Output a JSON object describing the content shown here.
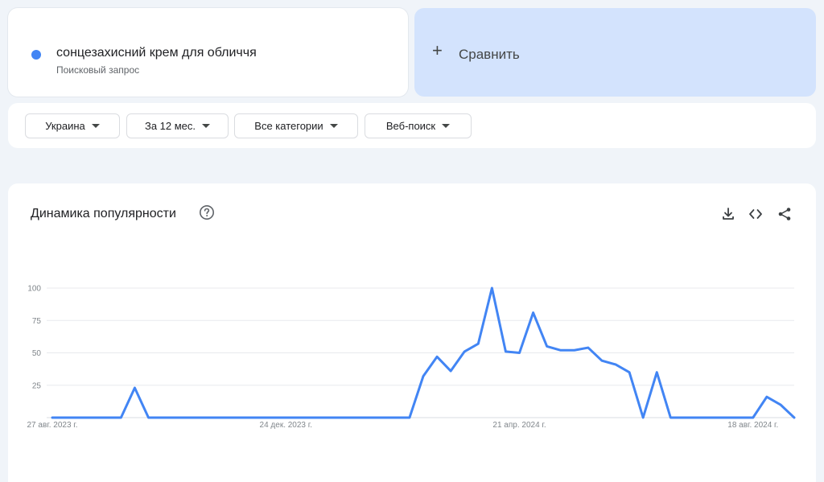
{
  "search_term": {
    "title": "сонцезахисний крем для обличчя",
    "subtitle": "Поисковый запрос",
    "color": "#4285f4"
  },
  "compare": {
    "icon": "plus-icon",
    "label": "Сравнить"
  },
  "filters": [
    {
      "label": "Украина",
      "icon": "caret-down-icon"
    },
    {
      "label": "За 12 мес.",
      "icon": "caret-down-icon"
    },
    {
      "label": "Все категории",
      "icon": "caret-down-icon"
    },
    {
      "label": "Веб-поиск",
      "icon": "caret-down-icon"
    }
  ],
  "chart_panel": {
    "title": "Динамика популярности",
    "help_icon": "help-circle-icon",
    "tools": [
      "download-icon",
      "embed-code-icon",
      "share-icon"
    ]
  },
  "colors": {
    "line": "#4285f4",
    "compare_bg": "#d3e3fd",
    "page_bg": "#f0f4f9",
    "grid": "#e8eaed"
  },
  "chart_data": {
    "type": "line",
    "x_tick_labels": [
      "27 авг. 2023 г.",
      "24 дек. 2023 г.",
      "21 апр. 2024 г.",
      "18 авг. 2024 г."
    ],
    "x_tick_indices": [
      0,
      17,
      34,
      51
    ],
    "y_ticks": [
      "25",
      "50",
      "75",
      "100"
    ],
    "y_tick_values": [
      25,
      50,
      75,
      100
    ],
    "ylim": [
      0,
      100
    ],
    "grid": true,
    "series": [
      {
        "values": [
          0,
          0,
          0,
          0,
          0,
          0,
          23,
          0,
          0,
          0,
          0,
          0,
          0,
          0,
          0,
          0,
          0,
          0,
          0,
          0,
          0,
          0,
          0,
          0,
          0,
          0,
          0,
          32,
          47,
          36,
          51,
          57,
          100,
          51,
          50,
          81,
          55,
          52,
          52,
          54,
          44,
          41,
          35,
          0,
          35,
          0,
          0,
          0,
          0,
          0,
          0,
          0,
          16,
          10,
          0
        ]
      }
    ]
  }
}
